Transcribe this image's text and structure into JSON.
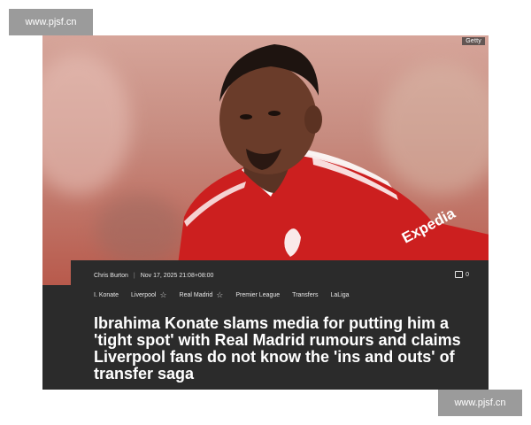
{
  "watermark": {
    "top_left": "www.pjsf.cn",
    "bottom_right": "www.pjsf.cn"
  },
  "photo": {
    "credit": "Getty",
    "shirt_sponsor": "Expedia"
  },
  "article": {
    "author": "Chris Burton",
    "timestamp": "Nov 17, 2025 21:08+08:00",
    "comment_count": "0",
    "tags": [
      {
        "label": "I. Konate",
        "starred": false
      },
      {
        "label": "Liverpool",
        "starred": true
      },
      {
        "label": "Real Madrid",
        "starred": true
      },
      {
        "label": "Premier League",
        "starred": false
      },
      {
        "label": "Transfers",
        "starred": false
      },
      {
        "label": "LaLiga",
        "starred": false
      }
    ],
    "headline": "Ibrahima Konate slams media for putting him a 'tight spot' with Real Madrid rumours and claims Liverpool fans do not know the 'ins and outs' of transfer saga"
  },
  "colors": {
    "shirt_red": "#cc1f1f",
    "panel": "#2b2b2b",
    "watermark_bg": "#9b9b9b"
  }
}
